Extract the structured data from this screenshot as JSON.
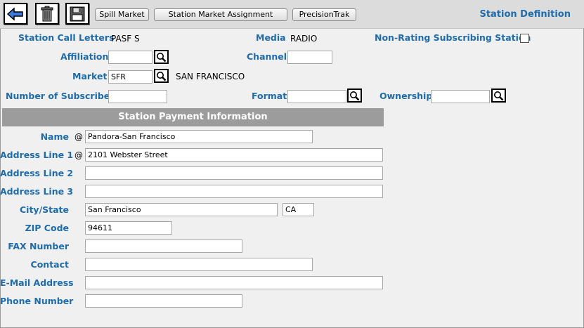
{
  "toolbar": {
    "icons": [
      "back-arrow-icon",
      "trash-icon",
      "save-disk-icon"
    ],
    "buttons": [
      "Spill Market",
      "Station Market Assignment",
      "PrecisionTrak"
    ],
    "page_title": "Station Definition"
  },
  "station": {
    "call_letters_label": "Station Call Letters",
    "call_letters_value": "PASF  S",
    "media_label": "Media",
    "media_value": "RADIO",
    "non_rating_label": "Non-Rating Subscribing Station",
    "non_rating_checked": false,
    "affiliation_label": "Affiliation",
    "affiliation_value": "",
    "channel_label": "Channel",
    "channel_value": "",
    "market_label": "Market",
    "market_value": "SFR",
    "market_name": "SAN FRANCISCO",
    "subscribers_label": "Number of Subscribers",
    "subscribers_value": "",
    "format_label": "Format",
    "format_value": "",
    "ownership_label": "Ownership",
    "ownership_value": ""
  },
  "payment": {
    "section_title": "Station Payment Information",
    "at_symbol": "@",
    "name_label": "Name",
    "name_value": "Pandora-San Francisco",
    "address1_label": "Address Line 1",
    "address1_value": "2101 Webster Street",
    "address2_label": "Address Line 2",
    "address2_value": "",
    "address3_label": "Address Line 3",
    "address3_value": "",
    "city_state_label": "City/State",
    "city_value": "San Francisco",
    "state_value": "CA",
    "zip_label": "ZIP Code",
    "zip_value": "94611",
    "fax_label": "FAX Number",
    "fax_value": "",
    "contact_label": "Contact",
    "contact_value": "",
    "email_label": "E-Mail Address",
    "email_value": "",
    "phone_label": "Phone Number",
    "phone_value": ""
  },
  "colors": {
    "label_blue": "#1f6cad",
    "section_bar_gray": "#9c9c9c",
    "toolbar_gray": "#dcdcdc"
  }
}
